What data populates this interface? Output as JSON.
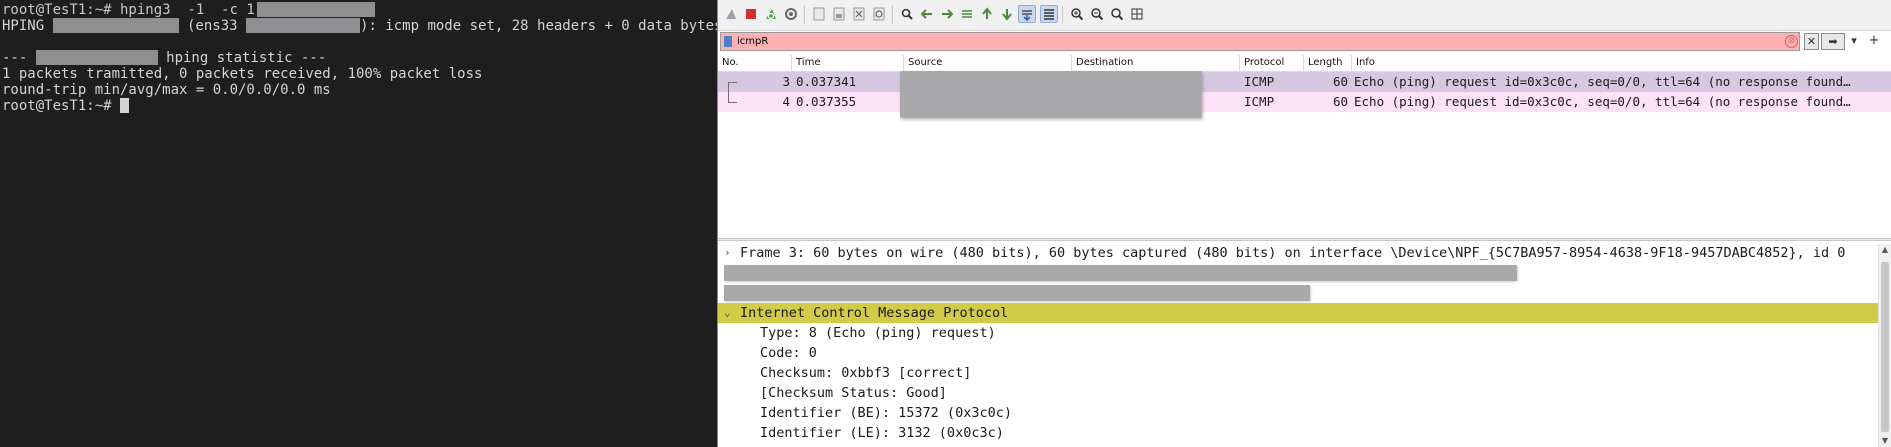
{
  "terminal": {
    "line1_prompt": "root@TesT1:~# hping3  -1  -c 1",
    "line2_a": "HPING ",
    "line2_b": " (ens33 ",
    "line2_c": "): icmp mode set, 28 headers + 0 data bytes",
    "line4_a": "--- ",
    "line4_b": " hping statistic ---",
    "line5": "1 packets tramitted, 0 packets received, 100% packet loss",
    "line6": "round-trip min/avg/max = 0.0/0.0/0.0 ms",
    "line7_prompt": "root@TesT1:~# "
  },
  "wireshark": {
    "filter": {
      "value": "icmpR",
      "clear_symbol": "⊘",
      "close_symbol": "✕",
      "apply_symbol": "➡",
      "dropdown_symbol": "▾",
      "add_symbol": "+"
    },
    "columns": {
      "no": "No.",
      "time": "Time",
      "source": "Source",
      "destination": "Destination",
      "protocol": "Protocol",
      "length": "Length",
      "info": "Info"
    },
    "packets": [
      {
        "no": "3",
        "time": "0.037341",
        "protocol": "ICMP",
        "length": "60",
        "info": "Echo (ping) request  id=0x3c0c, seq=0/0, ttl=64 (no response found…",
        "color": "#d8c7e0"
      },
      {
        "no": "4",
        "time": "0.037355",
        "protocol": "ICMP",
        "length": "60",
        "info": "Echo (ping) request  id=0x3c0c, seq=0/0, ttl=64 (no response found…",
        "color": "#fde1f7"
      }
    ],
    "details": {
      "frame": "Frame 3: 60 bytes on wire (480 bits), 60 bytes captured (480 bits) on interface \\Device\\NPF_{5C7BA957-8954-4638-9F18-9457DABC4852}, id 0",
      "icmp": "Internet Control Message Protocol",
      "type": "Type: 8 (Echo (ping) request)",
      "code": "Code: 0",
      "checksum": "Checksum: 0xbbf3 [correct]",
      "checksum_status": "[Checksum Status: Good]",
      "id_be": "Identifier (BE): 15372 (0x3c0c)",
      "id_le": "Identifier (LE): 3132 (0x0c3c)",
      "collapsed_glyph": "›",
      "expanded_glyph": "⌄",
      "highlight_color": "#d2cb48"
    },
    "toolbar_icons": [
      "shark-fin-start-icon",
      "stop-capture-icon",
      "restart-capture-icon",
      "capture-options-icon",
      "open-file-icon",
      "save-file-icon",
      "close-file-icon",
      "reload-file-icon",
      "find-packet-icon",
      "go-back-icon",
      "go-forward-icon",
      "go-to-packet-icon",
      "first-packet-icon",
      "last-packet-icon",
      "autoscroll-icon",
      "colorize-icon",
      "zoom-in-icon",
      "zoom-out-icon",
      "zoom-reset-icon",
      "resize-columns-icon"
    ]
  }
}
